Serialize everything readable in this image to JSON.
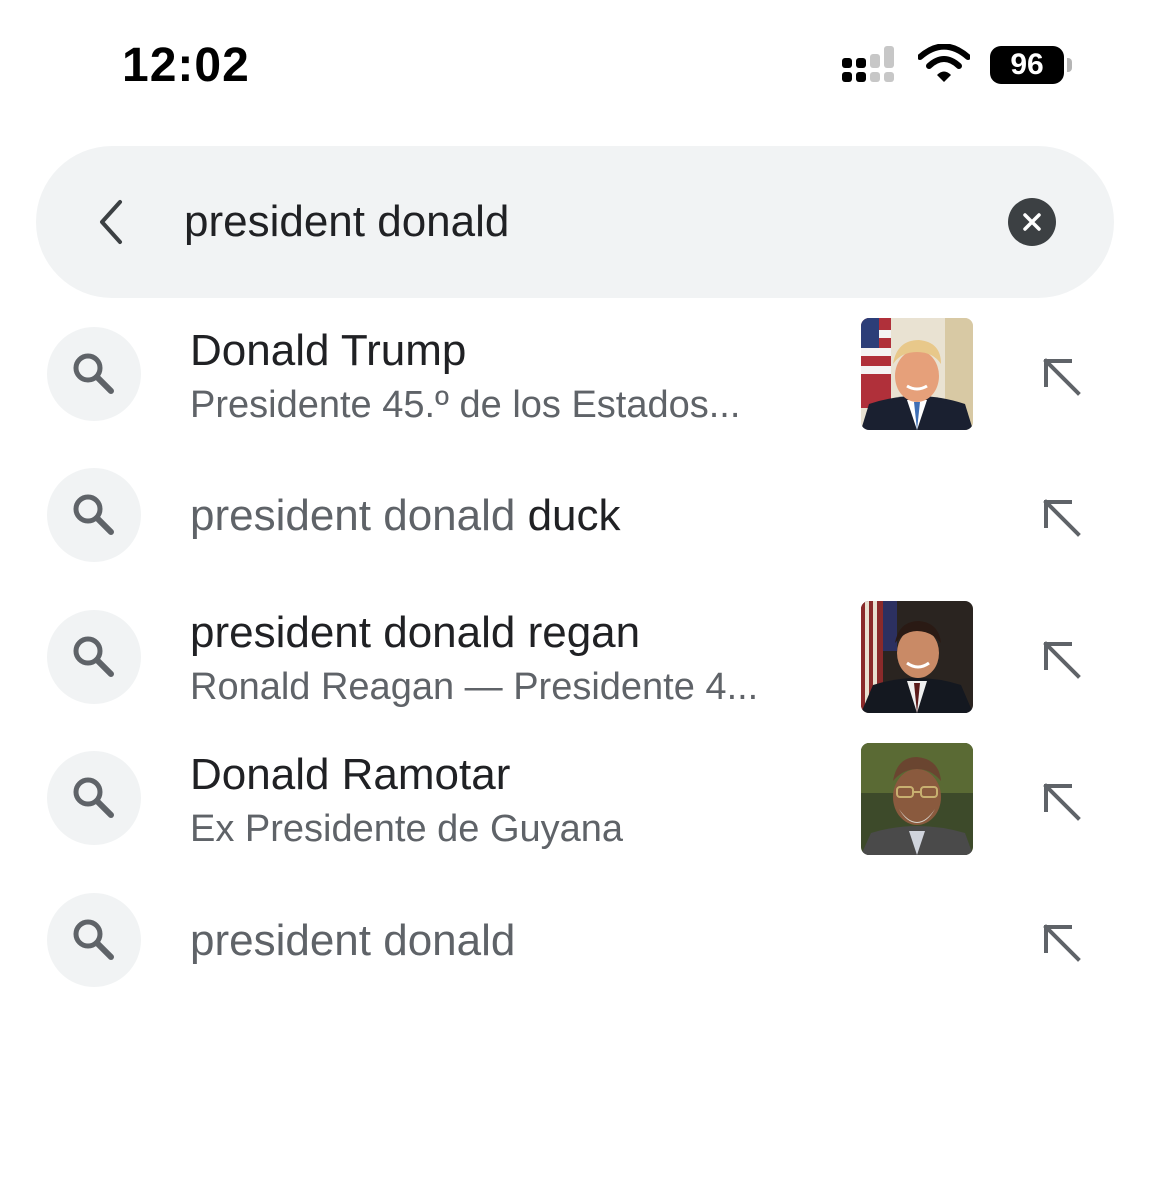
{
  "status_bar": {
    "time": "12:02",
    "battery": "96"
  },
  "search": {
    "query": "president donald",
    "back_icon": "chevron-left-icon",
    "clear_icon": "close-circle-icon"
  },
  "suggestions": [
    {
      "title": "Donald Trump",
      "subtitle": "Presidente 45.º de los Estados...",
      "has_thumbnail": true
    },
    {
      "title_prefix": "president donald",
      "title_suffix": " duck",
      "has_thumbnail": false
    },
    {
      "title": "president donald regan",
      "subtitle": "Ronald Reagan — Presidente 4...",
      "has_thumbnail": true
    },
    {
      "title": "Donald Ramotar",
      "subtitle": "Ex Presidente de Guyana",
      "has_thumbnail": true
    },
    {
      "title_prefix": "president donald",
      "title_suffix": "",
      "has_thumbnail": false
    }
  ],
  "colors": {
    "search_bg": "#f1f3f4",
    "text_primary": "#202124",
    "text_secondary": "#5f6368",
    "icon": "#5f6368"
  }
}
